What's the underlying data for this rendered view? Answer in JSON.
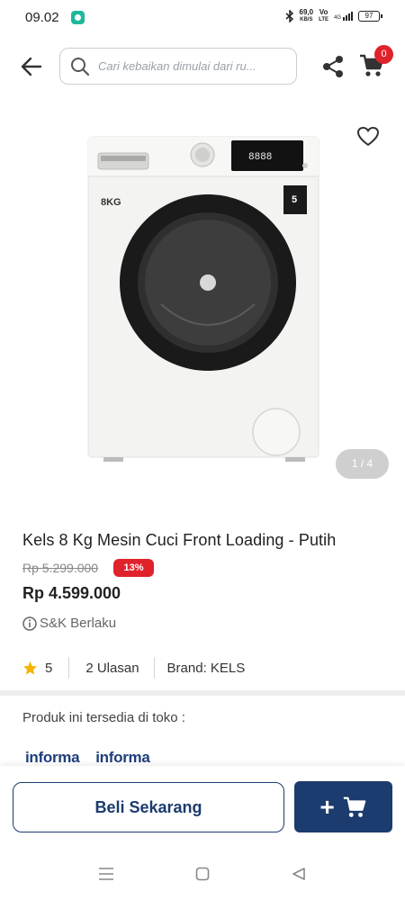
{
  "status_bar": {
    "time": "09.02",
    "net_speed": "69,0",
    "net_unit": "KB/S",
    "network_top": "Vo",
    "network_bottom": "LTE",
    "signal_label": "4G",
    "battery": "97"
  },
  "header": {
    "search_placeholder": "Cari kebaikan dimulai dari ru...",
    "cart_count": "0"
  },
  "gallery": {
    "counter": "1 / 4",
    "product_panel_text": "8888",
    "product_capacity": "8KG",
    "product_warranty": "5"
  },
  "product": {
    "title": "Kels 8 Kg Mesin Cuci Front Loading - Putih",
    "old_price": "Rp 5.299.000",
    "discount": "13%",
    "price": "Rp 4.599.000",
    "promo": "S&K Berlaku",
    "rating": "5",
    "reviews": "2 Ulasan",
    "brand": "Brand: KELS"
  },
  "availability": {
    "heading": "Produk ini tersedia di toko :",
    "stores": [
      "informa",
      "informa"
    ]
  },
  "actions": {
    "buy_now": "Beli Sekarang",
    "add_to_cart_symbol": "+"
  },
  "colors": {
    "primary": "#1c3b6e",
    "badge_red": "#e0232b",
    "rating_star": "#f4b400"
  }
}
